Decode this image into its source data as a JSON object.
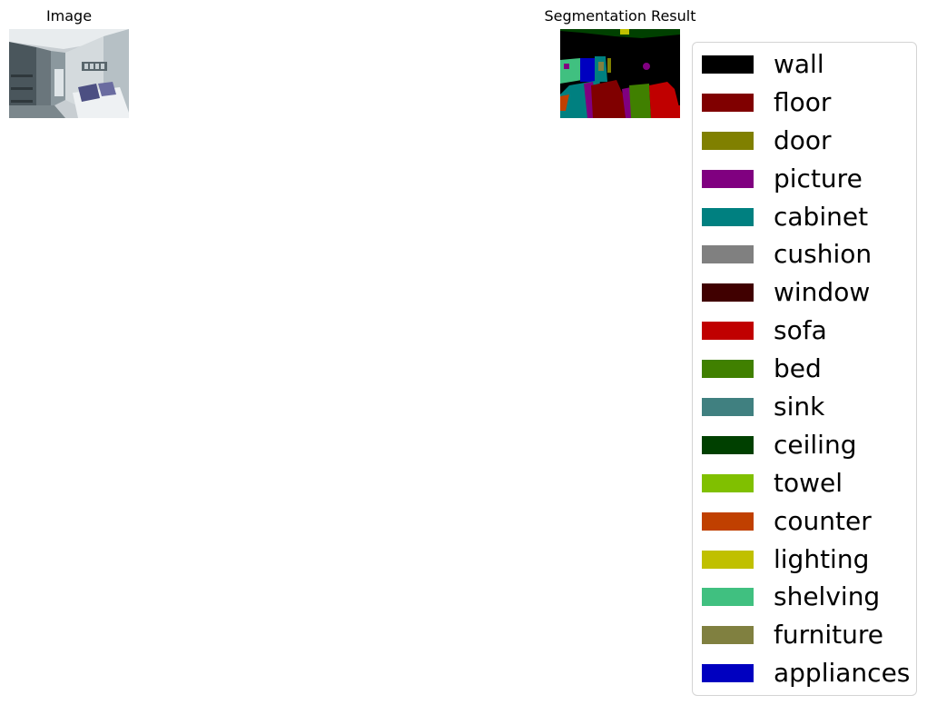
{
  "panels": {
    "image_title": "Image",
    "segmentation_title": "Segmentation Result"
  },
  "legend": {
    "items": [
      {
        "label": "wall",
        "color": "#000000"
      },
      {
        "label": "floor",
        "color": "#800000"
      },
      {
        "label": "door",
        "color": "#808000"
      },
      {
        "label": "picture",
        "color": "#800080"
      },
      {
        "label": "cabinet",
        "color": "#008080"
      },
      {
        "label": "cushion",
        "color": "#808080"
      },
      {
        "label": "window",
        "color": "#400000"
      },
      {
        "label": "sofa",
        "color": "#c00000"
      },
      {
        "label": "bed",
        "color": "#408000"
      },
      {
        "label": "sink",
        "color": "#408080"
      },
      {
        "label": "ceiling",
        "color": "#004000"
      },
      {
        "label": "towel",
        "color": "#80c000"
      },
      {
        "label": "counter",
        "color": "#c04000"
      },
      {
        "label": "lighting",
        "color": "#c0c000"
      },
      {
        "label": "shelving",
        "color": "#40c080"
      },
      {
        "label": "furniture",
        "color": "#808040"
      },
      {
        "label": "appliances",
        "color": "#0000c0"
      }
    ]
  }
}
